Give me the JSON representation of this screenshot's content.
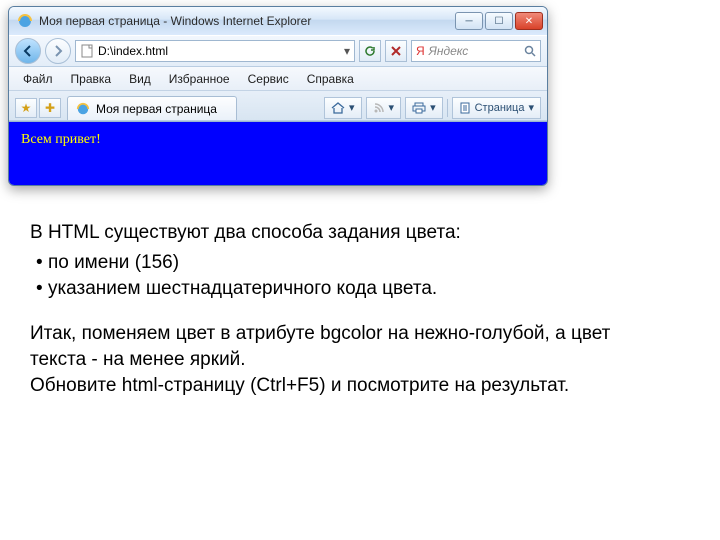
{
  "window": {
    "title": "Моя первая страница - Windows Internet Explorer"
  },
  "address": {
    "url": "D:\\index.html"
  },
  "search": {
    "placeholder": "Яндекс"
  },
  "menu": {
    "file": "Файл",
    "edit": "Правка",
    "view": "Вид",
    "favorites": "Избранное",
    "tools": "Сервис",
    "help": "Справка"
  },
  "tab": {
    "title": "Моя первая страница"
  },
  "toolbar": {
    "page": "Страница"
  },
  "page": {
    "hello": "Всем привет!"
  },
  "article": {
    "line1": "В HTML существуют два способа задания цвета:",
    "b1": "по имени (156)",
    "b2": "указанием шестнадцатеричного кода цвета.",
    "line2": "Итак, поменяем цвет в атрибуте bgcolor на нежно-голубой, а цвет текста - на менее яркий.",
    "line3": "Обновите html-страницу (Ctrl+F5) и посмотрите на результат."
  },
  "colors": {
    "page_bg": "#0000ff",
    "page_text": "#ffff00"
  }
}
